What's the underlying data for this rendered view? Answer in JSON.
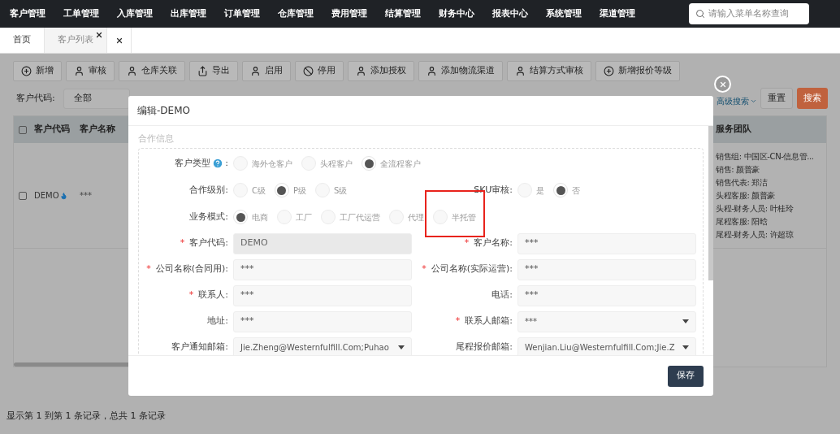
{
  "nav": {
    "menu": [
      "客户管理",
      "工单管理",
      "入库管理",
      "出库管理",
      "订单管理",
      "仓库管理",
      "费用管理",
      "结算管理",
      "财务中心",
      "报表中心",
      "系统管理",
      "渠道管理"
    ],
    "search": {
      "placeholder": "请输入菜单名称查询"
    }
  },
  "tabs": [
    {
      "label": "首页",
      "selected": false,
      "closable": false
    },
    {
      "label": "客户列表",
      "selected": true,
      "closable": true
    }
  ],
  "toolbar": [
    {
      "label": "新增",
      "kind": "add"
    },
    {
      "label": "审核",
      "kind": "user"
    },
    {
      "label": "仓库关联",
      "kind": "user"
    },
    {
      "label": "导出",
      "kind": "export"
    },
    {
      "label": "启用",
      "kind": "user"
    },
    {
      "label": "停用",
      "kind": "ban"
    },
    {
      "label": "添加授权",
      "kind": "user"
    },
    {
      "label": "添加物流渠道",
      "kind": "user"
    },
    {
      "label": "结算方式审核",
      "kind": "user"
    },
    {
      "label": "新增报价等级",
      "kind": "add"
    }
  ],
  "filter": {
    "label": "客户代码:",
    "value": "全部",
    "advanced": "高级搜索",
    "reset": "重置",
    "search": "搜索"
  },
  "table": {
    "header_checked": false,
    "columns": [
      "客户代码",
      "客户名称",
      "服务团队"
    ],
    "rows": [
      {
        "checked": false,
        "customer_code": "DEMO",
        "customer_name": "***",
        "service_team": [
          "销售组: 中国区-CN-信息管...",
          "销售: 颜普豪",
          "销售代表: 郑洁",
          "头程客服: 颜普豪",
          "头程-财务人员: 叶桂玲",
          "尾程客服: 阳晗",
          "尾程-财务人员: 许超琼"
        ]
      }
    ]
  },
  "status_bar": "显示第 1 到第 1 条记录，总共 1 条记录",
  "modal": {
    "title": "编辑-DEMO",
    "section": "合作信息",
    "save": "保存",
    "rows": [
      [
        {
          "kind": "radio",
          "label": "客户类型",
          "help": true,
          "colon": ":",
          "options": [
            {
              "label": "海外仓客户",
              "selected": false
            },
            {
              "label": "头程客户",
              "selected": false
            },
            {
              "label": "全流程客户",
              "selected": true
            }
          ]
        }
      ],
      [
        {
          "kind": "radio",
          "label": "合作级别:",
          "options": [
            {
              "label": "C级",
              "selected": false
            },
            {
              "label": "P级",
              "selected": true
            },
            {
              "label": "S级",
              "selected": false
            }
          ]
        },
        {
          "kind": "radio",
          "label": "SKU审核:",
          "options": [
            {
              "label": "是",
              "selected": false
            },
            {
              "label": "否",
              "selected": true
            }
          ]
        }
      ],
      [
        {
          "kind": "radio",
          "label": "业务模式:",
          "options": [
            {
              "label": "电商",
              "selected": true
            },
            {
              "label": "工厂",
              "selected": false
            },
            {
              "label": "工厂代运营",
              "selected": false
            },
            {
              "label": "代理",
              "selected": false
            },
            {
              "label": "半托管",
              "selected": false,
              "highlighted": true
            }
          ]
        }
      ],
      [
        {
          "kind": "input",
          "required": "*",
          "label": "客户代码:",
          "disabled": true,
          "value": "DEMO"
        },
        {
          "kind": "input",
          "required": "*",
          "label": "客户名称:",
          "value": "***"
        }
      ],
      [
        {
          "kind": "input",
          "required": "*",
          "label": "公司名称(合同用):",
          "value": "***"
        },
        {
          "kind": "input",
          "required": "*",
          "label": "公司名称(实际运营):",
          "value": "***"
        }
      ],
      [
        {
          "kind": "input",
          "required": "*",
          "label": "联系人:",
          "value": "***"
        },
        {
          "kind": "input",
          "label": "电话:",
          "value": "***"
        }
      ],
      [
        {
          "kind": "input",
          "label": "地址:",
          "value": "***"
        },
        {
          "kind": "select",
          "required": "*",
          "label": "联系人邮箱:",
          "value": "***"
        }
      ],
      [
        {
          "kind": "select",
          "label": "客户通知邮箱:",
          "value": "Jie.Zheng@Westernfulfill.Com;Puhao"
        },
        {
          "kind": "select",
          "label": "尾程报价邮箱:",
          "value": "Wenjian.Liu@Westernfulfill.Com;Jie.Z"
        }
      ]
    ]
  }
}
